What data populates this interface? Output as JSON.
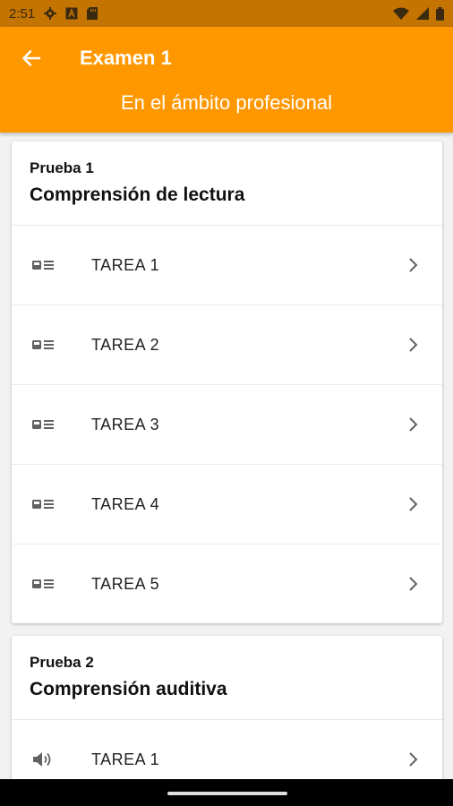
{
  "status_bar": {
    "time": "2:51",
    "left_icons": [
      "gear-icon",
      "a-box-icon",
      "sd-card-icon"
    ],
    "right_icons": [
      "wifi-icon",
      "signal-icon",
      "battery-icon"
    ]
  },
  "app_bar": {
    "title": "Examen 1",
    "subtitle": "En el ámbito profesional",
    "color": "#ff9800"
  },
  "sections": [
    {
      "kicker": "Prueba 1",
      "title": "Comprensión de lectura",
      "icon": "reading-icon",
      "items": [
        {
          "label": "TAREA 1"
        },
        {
          "label": "TAREA 2"
        },
        {
          "label": "TAREA 3"
        },
        {
          "label": "TAREA 4"
        },
        {
          "label": "TAREA 5"
        }
      ]
    },
    {
      "kicker": "Prueba 2",
      "title": "Comprensión auditiva",
      "icon": "speaker-icon",
      "items": [
        {
          "label": "TAREA 1"
        }
      ]
    }
  ]
}
